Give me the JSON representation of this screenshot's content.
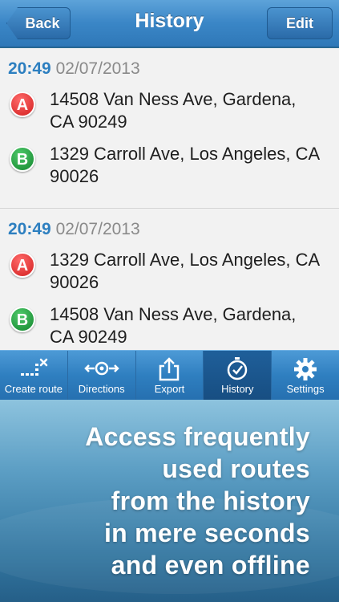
{
  "navbar": {
    "title": "History",
    "back_label": "Back",
    "edit_label": "Edit"
  },
  "history": [
    {
      "time": "20:49",
      "date": "02/07/2013",
      "stops": [
        {
          "marker": "A",
          "address": "14508 Van Ness Ave, Gardena, CA 90249"
        },
        {
          "marker": "B",
          "address": "1329 Carroll Ave, Los Angeles, CA 90026"
        }
      ]
    },
    {
      "time": "20:49",
      "date": "02/07/2013",
      "stops": [
        {
          "marker": "A",
          "address": "1329 Carroll Ave, Los Angeles, CA 90026"
        },
        {
          "marker": "B",
          "address": "14508 Van Ness Ave, Gardena, CA 90249"
        }
      ]
    }
  ],
  "tabs": [
    {
      "label": "Create route",
      "icon": "create-route-icon",
      "active": false
    },
    {
      "label": "Directions",
      "icon": "directions-icon",
      "active": false
    },
    {
      "label": "Export",
      "icon": "export-icon",
      "active": false
    },
    {
      "label": "History",
      "icon": "history-icon",
      "active": true
    },
    {
      "label": "Settings",
      "icon": "gear-icon",
      "active": false
    }
  ],
  "promo": {
    "lines": [
      "Access frequently",
      "used routes",
      "from the history",
      "in mere seconds",
      "and even offline"
    ]
  },
  "colors": {
    "accent": "#2f78b8",
    "time": "#2d7fc0",
    "marker_a": "#d21e1e",
    "marker_b": "#13862e"
  }
}
